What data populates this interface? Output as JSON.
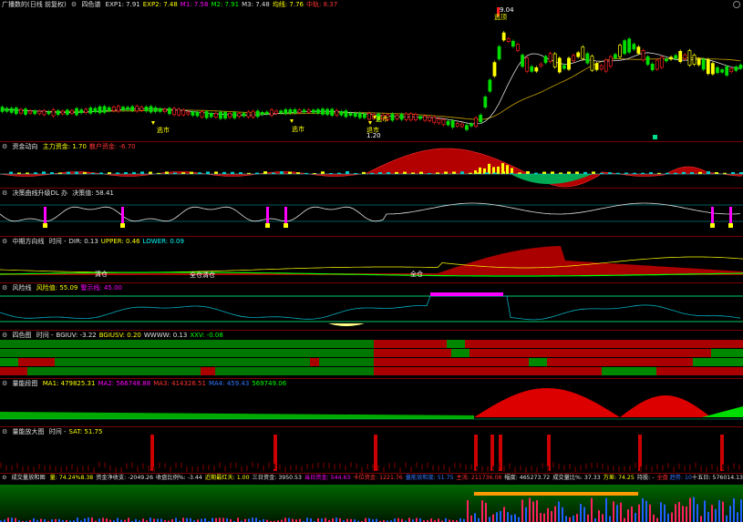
{
  "panels": {
    "main": {
      "title": "广播数的(日线 前复权)",
      "indicator": "四色谱",
      "params": [
        {
          "text": "EXP1: 7.91",
          "color": "#e0e0e0"
        },
        {
          "text": "EXP2: 7.48",
          "color": "#ffff00"
        },
        {
          "text": "M1: 7.58",
          "color": "#ff00ff"
        },
        {
          "text": "M2: 7.91",
          "color": "#00ff00"
        },
        {
          "text": "M3: 7.48",
          "color": "#e0e0e0"
        },
        {
          "text": "均线: 7.76",
          "color": "#ffff00"
        },
        {
          "text": "中轨: 8.37",
          "color": "#ff3333"
        }
      ],
      "price_high": "9.04",
      "price_low": "1.20",
      "labels": {
        "leave": "逃顶",
        "escape": "逃市",
        "retreat": "退市"
      }
    },
    "fund": {
      "title": "资金动向",
      "params": [
        {
          "text": "主力资金: 1.70",
          "color": "#ffff00"
        },
        {
          "text": "散户资金: -6.70",
          "color": "#ff3333"
        }
      ]
    },
    "turn": {
      "title": "决策曲线升级DL 办",
      "params": [
        {
          "text": "决策值: 58.41",
          "color": "#e0e0e0"
        }
      ]
    },
    "trend": {
      "title": "中期方向线",
      "params": [
        {
          "text": "时间 -",
          "color": "#e0e0e0"
        },
        {
          "text": "DIR: 0.13",
          "color": "#e0e0e0"
        },
        {
          "text": "UPPER: 0.46",
          "color": "#ffff00"
        },
        {
          "text": "LOWER: 0.09",
          "color": "#00ffff"
        }
      ],
      "labels": {
        "clear": "清仓",
        "hold": "全仓",
        "clear2": "清仓",
        "hold2": "全仓"
      }
    },
    "risk": {
      "title": "风险线",
      "params": [
        {
          "text": "风险值: 55.09",
          "color": "#ffff00"
        },
        {
          "text": "警示线: 45.00",
          "color": "#ff00ff"
        }
      ]
    },
    "color4": {
      "title": "四色图",
      "params": [
        {
          "text": "时间 -",
          "color": "#e0e0e0"
        },
        {
          "text": "BGIUV: -3.22",
          "color": "#e0e0e0"
        },
        {
          "text": "BGIUSV: 0.20",
          "color": "#ffff00"
        },
        {
          "text": "WWWW: 0.13",
          "color": "#e0e0e0"
        },
        {
          "text": "XXV: -0.08",
          "color": "#00ff00"
        }
      ]
    },
    "volume": {
      "title": "量能段图",
      "params": [
        {
          "text": "MA1: 479825.31",
          "color": "#ffff00"
        },
        {
          "text": "MA2: 566748.88",
          "color": "#ff00ff"
        },
        {
          "text": "MA3: 414326.51",
          "color": "#ff3333"
        },
        {
          "text": "MA4: 459.43",
          "color": "#3377ff"
        },
        {
          "text": "569749.06",
          "color": "#00ff00"
        }
      ]
    },
    "signal": {
      "title": "量能放大图",
      "params": [
        {
          "text": "时间 -",
          "color": "#e0e0e0"
        },
        {
          "text": "SAT: 51.75",
          "color": "#ffff00"
        }
      ]
    },
    "bottom": {
      "title": "成交量放和图",
      "params": [
        {
          "text": "量: 74.24%8.38",
          "color": "#ffff00"
        },
        {
          "text": "资金净收支: -2049.26",
          "color": "#e0e0e0"
        },
        {
          "text": "收盘比例%: -3.44",
          "color": "#e0e0e0"
        },
        {
          "text": "近期最红天: 1.00",
          "color": "#ffff00"
        },
        {
          "text": "三日资金: 3950.53",
          "color": "#e0e0e0"
        },
        {
          "text": "当日资金: 544.63",
          "color": "#ff00ff"
        },
        {
          "text": "卡位资金: 1221.76",
          "color": "#ff3333"
        },
        {
          "text": "量能放和度: 51.75",
          "color": "#3377ff"
        },
        {
          "text": "主流: 211736.08",
          "color": "#ff3333"
        },
        {
          "text": "幅度: 465273.72",
          "color": "#e0e0e0"
        },
        {
          "text": "成交量比%: 37.33",
          "color": "#e0e0e0"
        },
        {
          "text": "方差: 74.25",
          "color": "#ffff00"
        },
        {
          "text": "持股: -",
          "color": "#e0e0e0"
        },
        {
          "text": "全盘: 21.23",
          "color": "#ff3333"
        },
        {
          "text": "全部: 40.53",
          "color": "#00ff00"
        },
        {
          "text": "差额: -18.81",
          "color": "#e0e0e0"
        },
        {
          "text": "持币: -",
          "color": "#ff3333"
        },
        {
          "text": "抛量: 7.70",
          "color": "#ff3333"
        }
      ],
      "right": [
        {
          "text": "趋势: 10",
          "color": "#3377ff"
        },
        {
          "text": "十五日: 576014.13",
          "color": "#e0e0e0"
        }
      ]
    }
  },
  "colors": {
    "up": "#ff2020",
    "down": "#00dd00",
    "accent": "#ffff00",
    "sep": "#7a0000"
  }
}
